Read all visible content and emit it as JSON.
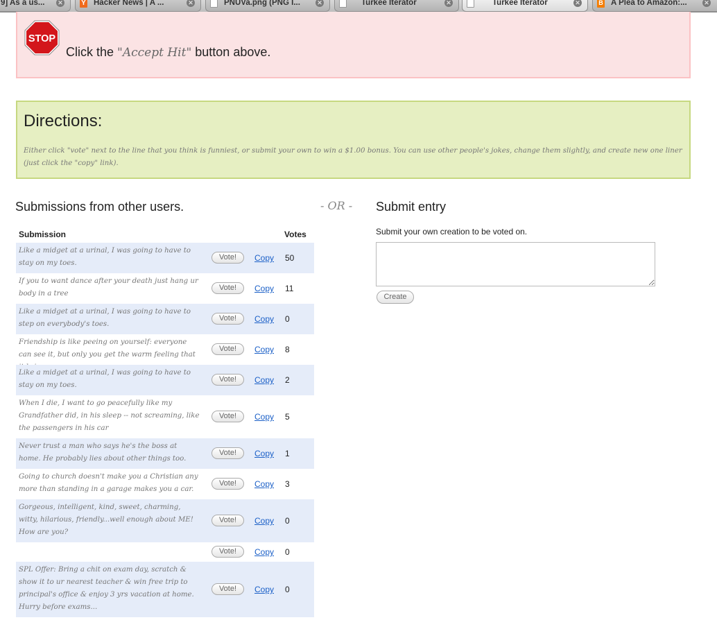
{
  "tabs": [
    {
      "label": "9] As a us...",
      "icon": "none",
      "active": false
    },
    {
      "label": "Hacker News | A ...",
      "icon": "y-combinator-icon",
      "active": false
    },
    {
      "label": "PNUVa.png (PNG I...",
      "icon": "image-file-icon",
      "active": false
    },
    {
      "label": "Turkee Iterator",
      "icon": "document-icon",
      "active": false
    },
    {
      "label": "Turkee Iterator",
      "icon": "document-icon",
      "active": true
    },
    {
      "label": "A Plea to Amazon:...",
      "icon": "blogger-icon",
      "active": false
    }
  ],
  "notice": {
    "prefix": "Click the ",
    "emphasis": "\"Accept Hit\"",
    "suffix": " button above.",
    "stop_label": "STOP"
  },
  "directions": {
    "title": "Directions:",
    "text": "Either click \"vote\" next to the line that you think is funniest, or submit your own to win a $1.00 bonus. You can use other people's jokes, change them slightly, and create new one liner (just click the \"copy\" link)."
  },
  "submissions": {
    "title": "Submissions from other users.",
    "col_submission": "Submission",
    "col_votes": "Votes",
    "vote_label": "Vote!",
    "copy_label": "Copy",
    "rows": [
      {
        "text": "Like a midget at a urinal, I was going to have to stay on my toes.",
        "votes": "50"
      },
      {
        "text": "If you to want dance after your death just hang ur body in a tree",
        "votes": "11"
      },
      {
        "text": "Like a midget at a urinal, I was going to have to step on everybody's toes.",
        "votes": "0"
      },
      {
        "text": "Friendship is like peeing on yourself: everyone can see it, but only you get the warm feeling that it brings.",
        "votes": "8"
      },
      {
        "text": "Like a midget at a urinal, I was going to have to stay on my toes.",
        "votes": "2"
      },
      {
        "text": "When I die, I want to go peacefully like my Grandfather did, in his sleep -- not screaming, like the passengers in his car",
        "votes": "5"
      },
      {
        "text": "Never trust a man who says he's the boss at home. He probably lies about other things too.",
        "votes": "1"
      },
      {
        "text": "Going to church doesn't make you a Christian any more than standing in a garage makes you a car.",
        "votes": "3"
      },
      {
        "text": "Gorgeous, intelligent, kind, sweet, charming, witty, hilarious, friendly...well enough about ME! How are you?",
        "votes": "0"
      },
      {
        "text": "",
        "votes": "0"
      },
      {
        "text": "SPL Offer: Bring a chit on exam day, scratch & show it to ur nearest teacher & win free trip to principal's office & enjoy 3 yrs vacation at home. Hurry before exams...",
        "votes": "0"
      }
    ]
  },
  "separator": "- OR -",
  "entry": {
    "title": "Submit entry",
    "description": "Submit your own creation to be voted on.",
    "value": "",
    "create_label": "Create"
  }
}
